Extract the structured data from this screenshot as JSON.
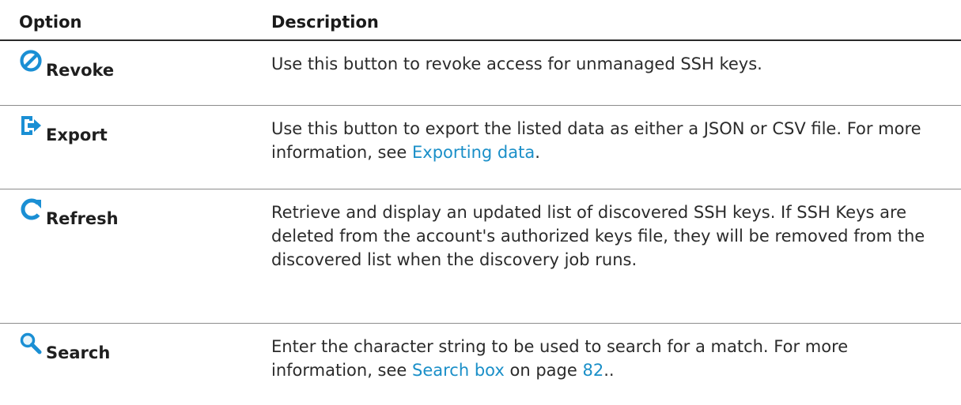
{
  "header": {
    "option": "Option",
    "description": "Description"
  },
  "rows": [
    {
      "icon": "revoke-icon",
      "label": "Revoke",
      "desc": "Use this button to revoke access for unmanaged SSH keys."
    },
    {
      "icon": "export-icon",
      "label": "Export",
      "desc_before": "Use this button to export the listed data as either a JSON or CSV file. For more information, see ",
      "link": "Exporting data",
      "desc_after": "."
    },
    {
      "icon": "refresh-icon",
      "label": "Refresh",
      "desc": "Retrieve and display an updated list of discovered SSH keys. If SSH Keys are deleted from the account's authorized keys file, they will be removed from the discovered list when the discovery job runs."
    },
    {
      "icon": "search-icon",
      "label": "Search",
      "desc_before": "Enter the character string to be used to search for a match. For more information, see ",
      "link": "Search box",
      "desc_middle": " on page ",
      "page_link": "82",
      "desc_after": ".."
    }
  ],
  "colors": {
    "icon_blue": "#1a8fd4",
    "link": "#1a8fc8"
  }
}
